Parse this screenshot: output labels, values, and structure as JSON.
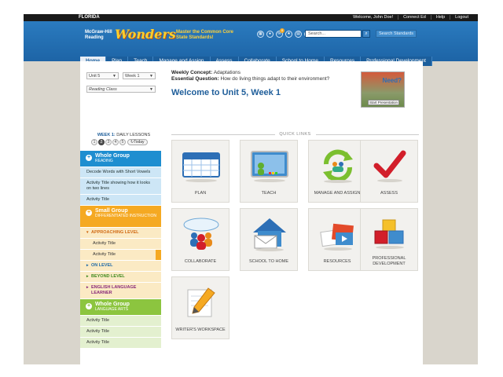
{
  "topbar": {
    "state": "FLORIDA",
    "welcome": "Welcome, John Doe!",
    "connect": "Connect Ed",
    "help": "Help",
    "logout": "Logout"
  },
  "header": {
    "brand_line1": "McGraw-Hill",
    "brand_line2": "Reading",
    "logo": "Wonders",
    "tagline_line1": "Master the Common Core",
    "tagline_line2": "State Standards!",
    "search_placeholder": "Search...",
    "search_standards": "Search Standards",
    "badge_count": "8"
  },
  "nav": [
    "Home",
    "Plan",
    "Teach",
    "Manage and Assign",
    "Assess",
    "Collaborate",
    "School to Home",
    "Resources",
    "Professional Development"
  ],
  "selectors": {
    "unit": "Unit 5",
    "week": "Week 1",
    "class": "Reading Class"
  },
  "concept": {
    "weekly_label": "Weekly Concept:",
    "weekly_value": "Adaptations",
    "question_label": "Essential Question:",
    "question_value": "How do living things adapt to their environment?",
    "welcome": "Welcome to Unit 5, Week 1"
  },
  "promo": {
    "text": "Need",
    "button": "Start Presentation"
  },
  "daily": {
    "week": "WEEK 1:",
    "label": "DAILY LESSONS",
    "days": [
      "1",
      "2",
      "3",
      "4",
      "5"
    ],
    "today": "Today"
  },
  "sidebar": {
    "whole_group_reading": {
      "title": "Whole Group",
      "sub": "READING"
    },
    "reading_items": [
      "Decode Words with Short Vowels",
      "Activity Title showing how it looks on two lines",
      "Activity Title"
    ],
    "small_group": {
      "title": "Small Group",
      "sub": "DIFFERENTIATED INSTRUCTION"
    },
    "approaching": "APPROACHING LEVEL",
    "approaching_items": [
      "Activity Title",
      "Activity Title"
    ],
    "on_level": "ON LEVEL",
    "beyond_level": "BEYOND LEVEL",
    "ell": "ENGLISH LANGUAGE LEARNER",
    "whole_group_la": {
      "title": "Whole Group",
      "sub": "LANGUAGE ARTS"
    },
    "la_items": [
      "Activity Title",
      "Activity Title",
      "Activity Title"
    ]
  },
  "quick_links": {
    "label": "QUICK LINKS",
    "tiles": [
      "PLAN",
      "TEACH",
      "MANAGE AND ASSIGN",
      "ASSESS",
      "COLLABORATE",
      "SCHOOL TO HOME",
      "RESOURCES",
      "PROFESSIONAL DEVELOPMENT",
      "WRITER'S WORKSPACE"
    ]
  }
}
